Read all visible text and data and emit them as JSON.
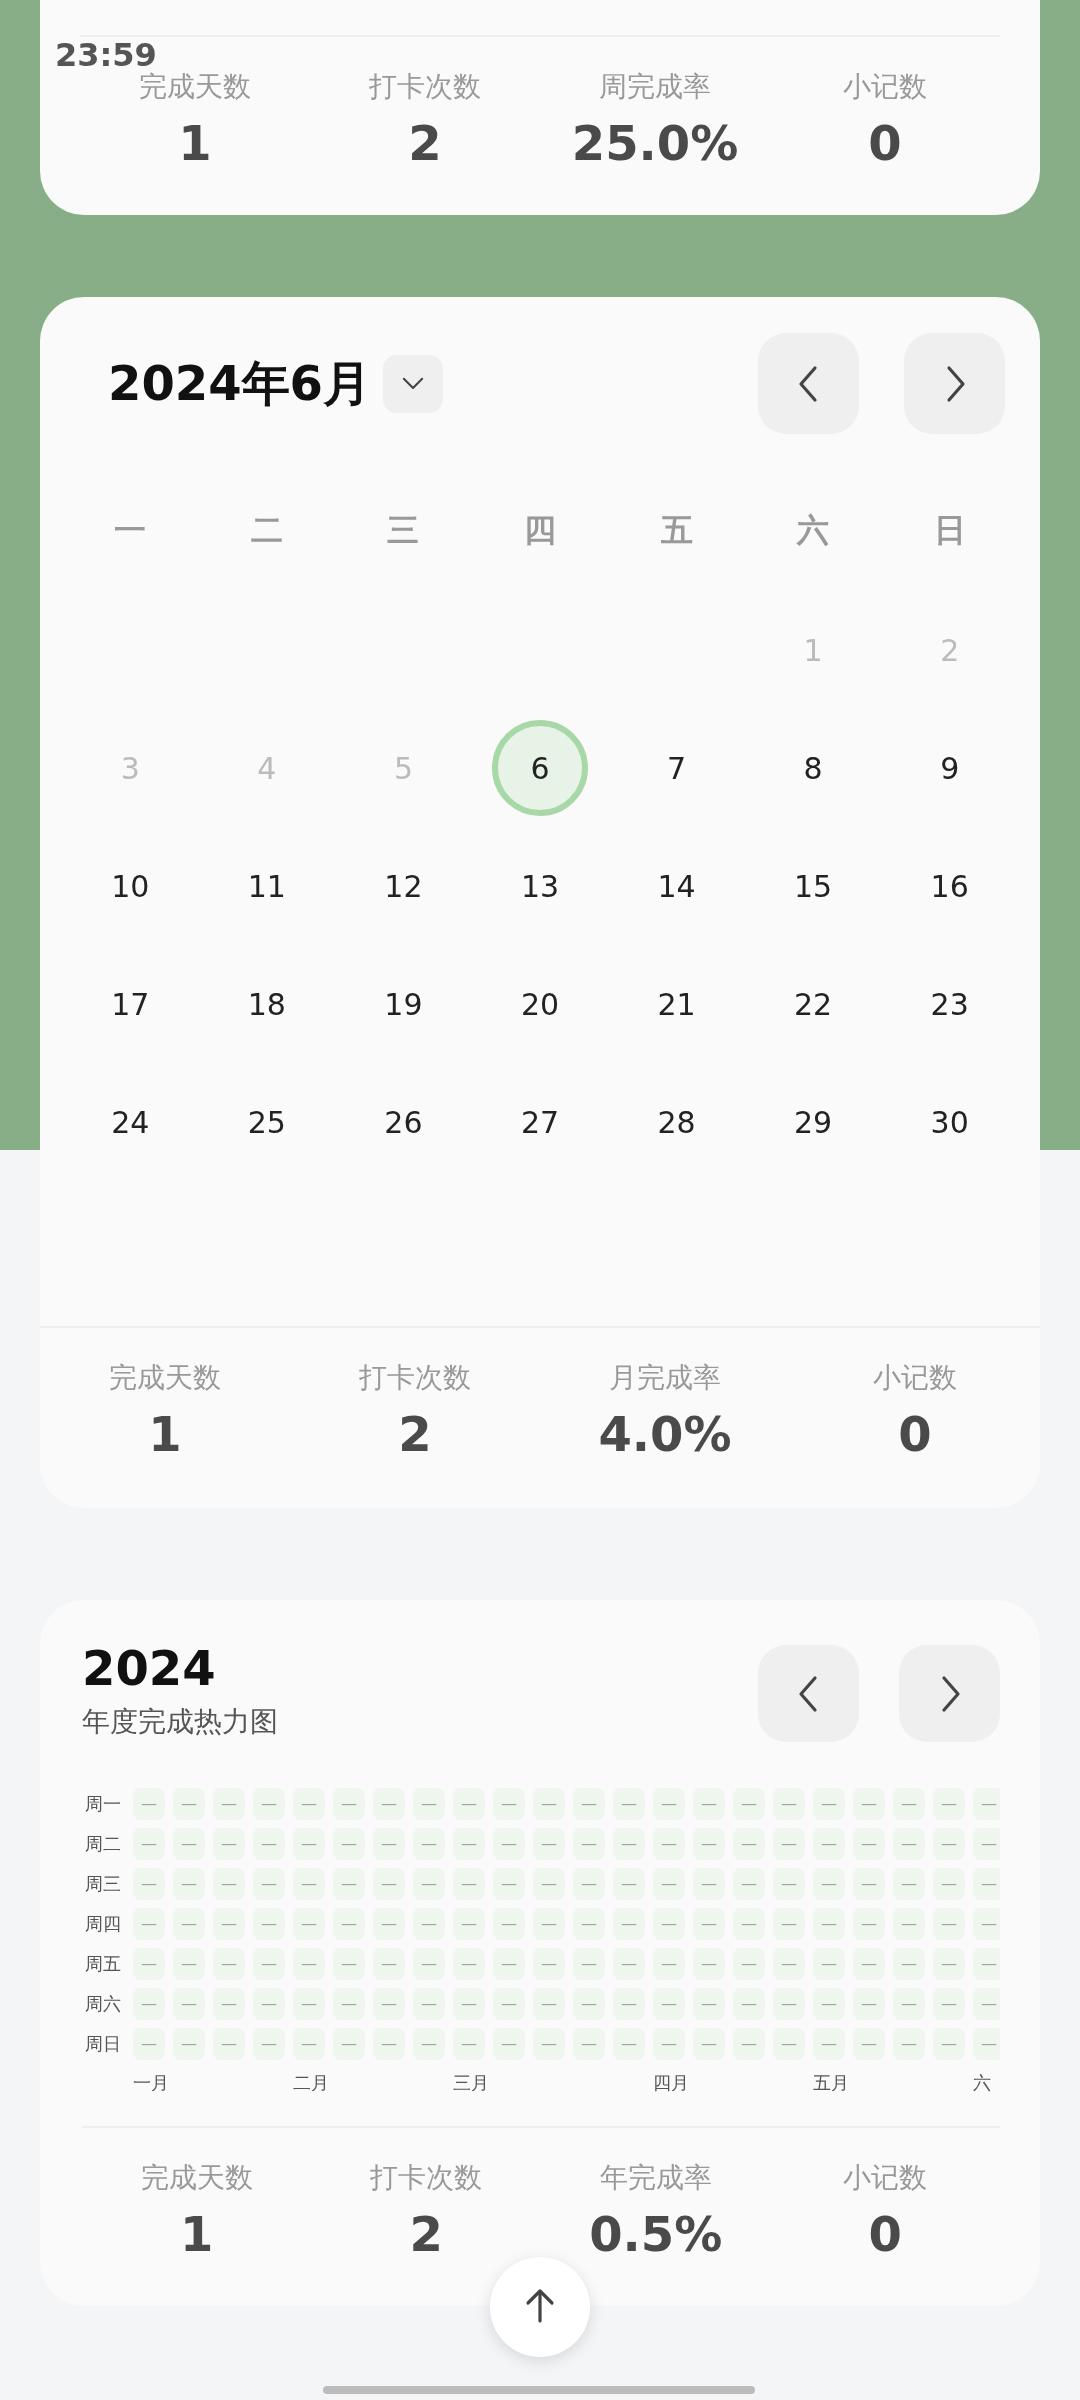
{
  "status_bar": {
    "time": "23:59"
  },
  "week_card": {
    "stats": [
      {
        "label": "完成天数",
        "value": "1"
      },
      {
        "label": "打卡次数",
        "value": "2"
      },
      {
        "label": "周完成率",
        "value": "25.0%"
      },
      {
        "label": "小记数",
        "value": "0"
      }
    ]
  },
  "month_card": {
    "title": "2024年6月",
    "weekdays": [
      "一",
      "二",
      "三",
      "四",
      "五",
      "六",
      "日"
    ],
    "weeks": [
      [
        {
          "kind": "empty"
        },
        {
          "kind": "empty"
        },
        {
          "kind": "empty"
        },
        {
          "kind": "empty"
        },
        {
          "kind": "empty"
        },
        {
          "kind": "day",
          "day": "1",
          "muted": true,
          "selected": false
        },
        {
          "kind": "day",
          "day": "2",
          "muted": true,
          "selected": false
        }
      ],
      [
        {
          "kind": "day",
          "day": "3",
          "muted": true,
          "selected": false
        },
        {
          "kind": "day",
          "day": "4",
          "muted": true,
          "selected": false
        },
        {
          "kind": "day",
          "day": "5",
          "muted": true,
          "selected": false
        },
        {
          "kind": "day",
          "day": "6",
          "muted": false,
          "selected": true
        },
        {
          "kind": "day",
          "day": "7",
          "muted": false,
          "selected": false
        },
        {
          "kind": "day",
          "day": "8",
          "muted": false,
          "selected": false
        },
        {
          "kind": "day",
          "day": "9",
          "muted": false,
          "selected": false
        }
      ],
      [
        {
          "kind": "day",
          "day": "10",
          "muted": false,
          "selected": false
        },
        {
          "kind": "day",
          "day": "11",
          "muted": false,
          "selected": false
        },
        {
          "kind": "day",
          "day": "12",
          "muted": false,
          "selected": false
        },
        {
          "kind": "day",
          "day": "13",
          "muted": false,
          "selected": false
        },
        {
          "kind": "day",
          "day": "14",
          "muted": false,
          "selected": false
        },
        {
          "kind": "day",
          "day": "15",
          "muted": false,
          "selected": false
        },
        {
          "kind": "day",
          "day": "16",
          "muted": false,
          "selected": false
        }
      ],
      [
        {
          "kind": "day",
          "day": "17",
          "muted": false,
          "selected": false
        },
        {
          "kind": "day",
          "day": "18",
          "muted": false,
          "selected": false
        },
        {
          "kind": "day",
          "day": "19",
          "muted": false,
          "selected": false
        },
        {
          "kind": "day",
          "day": "20",
          "muted": false,
          "selected": false
        },
        {
          "kind": "day",
          "day": "21",
          "muted": false,
          "selected": false
        },
        {
          "kind": "day",
          "day": "22",
          "muted": false,
          "selected": false
        },
        {
          "kind": "day",
          "day": "23",
          "muted": false,
          "selected": false
        }
      ],
      [
        {
          "kind": "day",
          "day": "24",
          "muted": false,
          "selected": false
        },
        {
          "kind": "day",
          "day": "25",
          "muted": false,
          "selected": false
        },
        {
          "kind": "day",
          "day": "26",
          "muted": false,
          "selected": false
        },
        {
          "kind": "day",
          "day": "27",
          "muted": false,
          "selected": false
        },
        {
          "kind": "day",
          "day": "28",
          "muted": false,
          "selected": false
        },
        {
          "kind": "day",
          "day": "29",
          "muted": false,
          "selected": false
        },
        {
          "kind": "day",
          "day": "30",
          "muted": false,
          "selected": false
        }
      ]
    ],
    "stats": [
      {
        "label": "完成天数",
        "value": "1"
      },
      {
        "label": "打卡次数",
        "value": "2"
      },
      {
        "label": "月完成率",
        "value": "4.0%"
      },
      {
        "label": "小记数",
        "value": "0"
      }
    ]
  },
  "year_card": {
    "title": "2024",
    "subtitle": "年度完成热力图",
    "row_labels": [
      "周一",
      "周二",
      "周三",
      "周四",
      "周五",
      "周六",
      "周日"
    ],
    "weeks": [
      {
        "month": "一月",
        "cells": [
          "—",
          "—",
          "—",
          "—",
          "—",
          "—",
          "—"
        ]
      },
      {
        "cells": [
          "—",
          "—",
          "—",
          "—",
          "—",
          "—",
          "—"
        ]
      },
      {
        "cells": [
          "—",
          "—",
          "—",
          "—",
          "—",
          "—",
          "—"
        ]
      },
      {
        "cells": [
          "—",
          "—",
          "—",
          "—",
          "—",
          "—",
          "—"
        ]
      },
      {
        "month": "二月",
        "cells": [
          "—",
          "—",
          "—",
          "—",
          "—",
          "—",
          "—"
        ]
      },
      {
        "cells": [
          "—",
          "—",
          "—",
          "—",
          "—",
          "—",
          "—"
        ]
      },
      {
        "cells": [
          "—",
          "—",
          "—",
          "—",
          "—",
          "—",
          "—"
        ]
      },
      {
        "cells": [
          "—",
          "—",
          "—",
          "—",
          "—",
          "—",
          "—"
        ]
      },
      {
        "month": "三月",
        "cells": [
          "—",
          "—",
          "—",
          "—",
          "—",
          "—",
          "—"
        ]
      },
      {
        "cells": [
          "—",
          "—",
          "—",
          "—",
          "—",
          "—",
          "—"
        ]
      },
      {
        "cells": [
          "—",
          "—",
          "—",
          "—",
          "—",
          "—",
          "—"
        ]
      },
      {
        "cells": [
          "—",
          "—",
          "—",
          "—",
          "—",
          "—",
          "—"
        ]
      },
      {
        "cells": [
          "—",
          "—",
          "—",
          "—",
          "—",
          "—",
          "—"
        ]
      },
      {
        "month": "四月",
        "cells": [
          "—",
          "—",
          "—",
          "—",
          "—",
          "—",
          "—"
        ]
      },
      {
        "cells": [
          "—",
          "—",
          "—",
          "—",
          "—",
          "—",
          "—"
        ]
      },
      {
        "cells": [
          "—",
          "—",
          "—",
          "—",
          "—",
          "—",
          "—"
        ]
      },
      {
        "cells": [
          "—",
          "—",
          "—",
          "—",
          "—",
          "—",
          "—"
        ]
      },
      {
        "month": "五月",
        "cells": [
          "—",
          "—",
          "—",
          "—",
          "—",
          "—",
          "—"
        ]
      },
      {
        "cells": [
          "—",
          "—",
          "—",
          "—",
          "—",
          "—",
          "—"
        ]
      },
      {
        "cells": [
          "—",
          "—",
          "—",
          "—",
          "—",
          "—",
          "—"
        ]
      },
      {
        "cells": [
          "—",
          "—",
          "—",
          "—",
          "—",
          "—",
          "—"
        ]
      },
      {
        "month": "六",
        "cells": [
          "—",
          "—",
          "—",
          "—",
          "—",
          "—",
          "—"
        ]
      }
    ],
    "stats": [
      {
        "label": "完成天数",
        "value": "1"
      },
      {
        "label": "打卡次数",
        "value": "2"
      },
      {
        "label": "年完成率",
        "value": "0.5%"
      },
      {
        "label": "小记数",
        "value": "0"
      }
    ]
  }
}
